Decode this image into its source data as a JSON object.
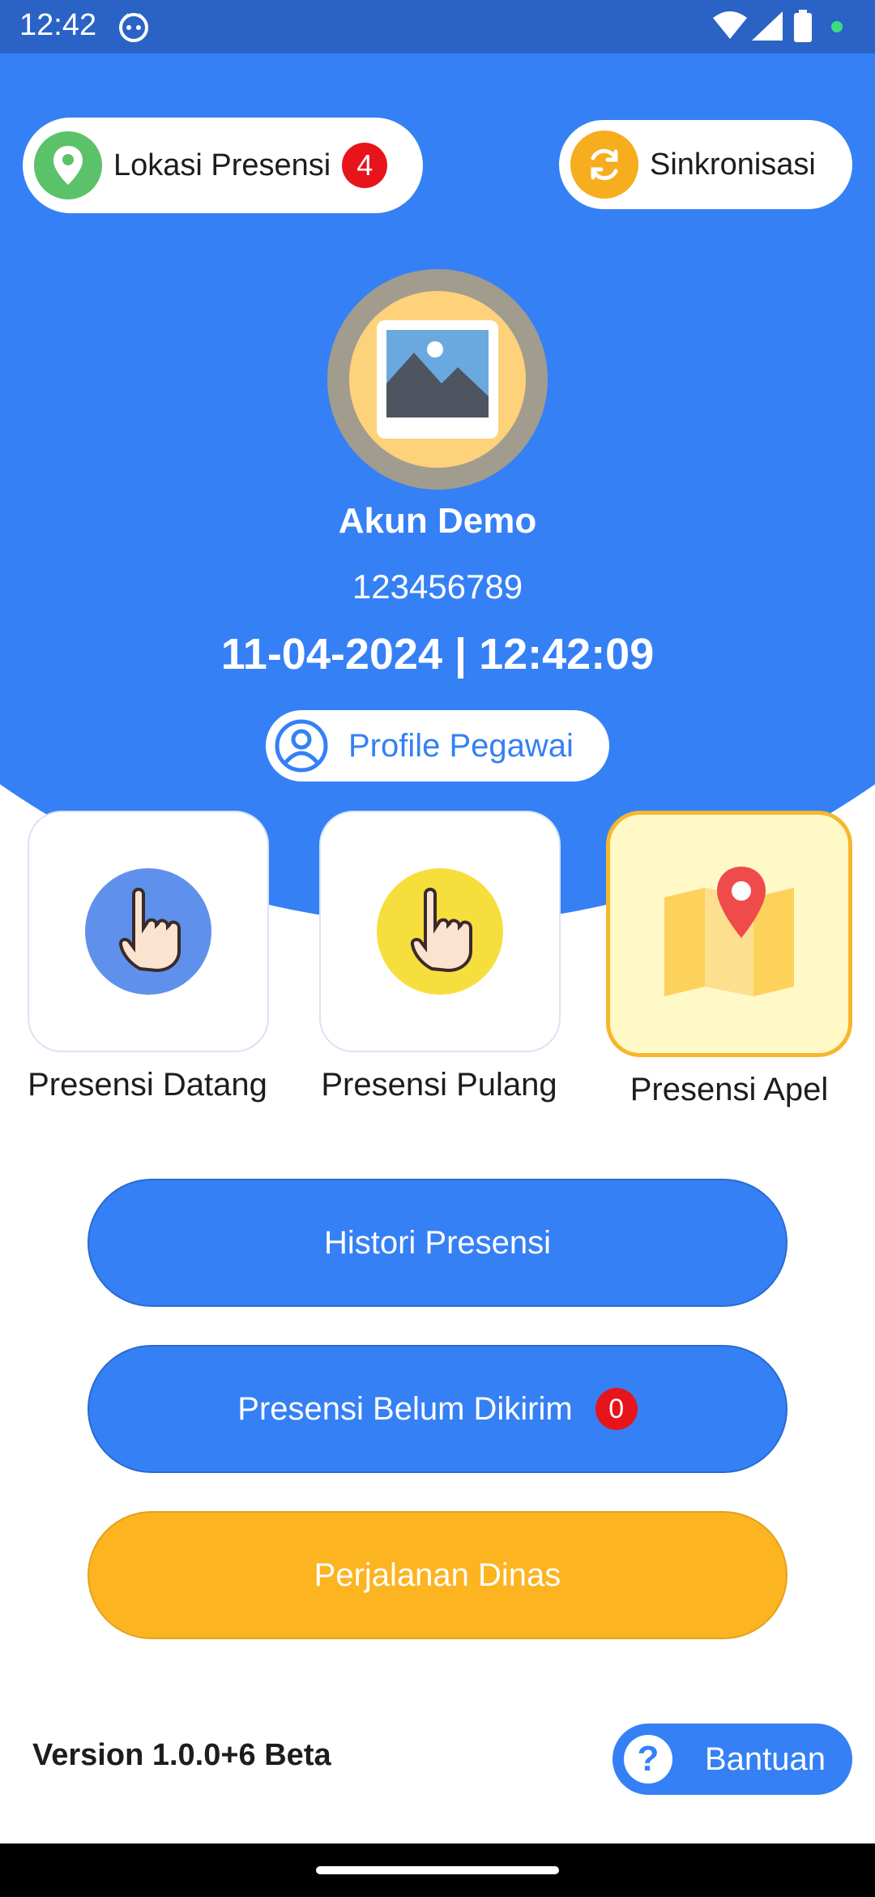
{
  "status_bar": {
    "time": "12:42"
  },
  "header": {
    "location_pill": {
      "label": "Lokasi Presensi",
      "badge_count": "4"
    },
    "sync_pill": {
      "label": "Sinkronisasi"
    }
  },
  "profile": {
    "name": "Akun Demo",
    "id": "123456789",
    "datetime": "11-04-2024 | 12:42:09",
    "profile_button_label": "Profile Pegawai"
  },
  "cards": [
    {
      "label": "Presensi Datang"
    },
    {
      "label": "Presensi Pulang"
    },
    {
      "label": "Presensi Apel"
    }
  ],
  "buttons": {
    "histori_label": "Histori Presensi",
    "belum_label": "Presensi Belum Dikirim",
    "belum_badge": "0",
    "dinas_label": "Perjalanan Dinas"
  },
  "footer": {
    "version": "Version 1.0.0+6 Beta",
    "help_label": "Bantuan"
  },
  "colors": {
    "primary": "#3580f5",
    "accent": "#fcb421",
    "badge": "#e8141c"
  }
}
